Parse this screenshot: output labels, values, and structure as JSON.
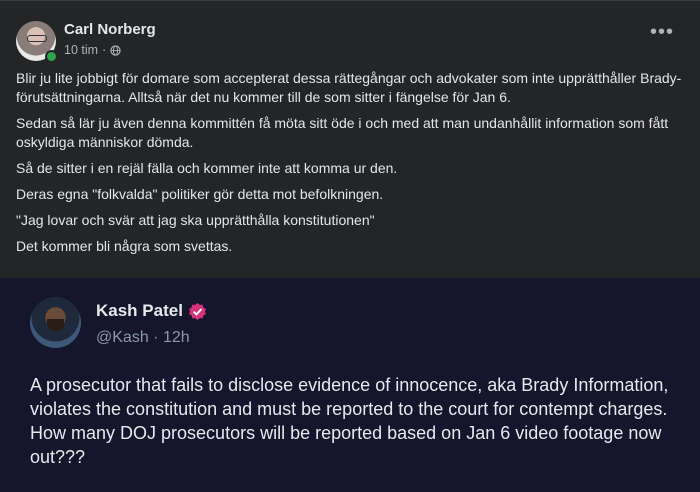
{
  "post": {
    "author": "Carl Norberg",
    "time": "10 tim",
    "separator": "·",
    "privacy_icon": "globe-icon",
    "more_icon": "more-options-icon",
    "paragraphs": [
      "Blir ju lite jobbigt för domare som accepterat dessa rättegångar och advokater som inte upprätthåller Brady-förutsättningarna. Alltså när det nu kommer till de som sitter i fängelse för Jan 6.",
      "Sedan så lär ju även denna kommittén få möta sitt öde i och med att man undanhållit information som fått oskyldiga människor dömda.",
      "Så de sitter i en rejäl fälla och kommer inte att komma ur den.",
      "Deras egna \"folkvalda\" politiker gör detta mot befolkningen.",
      "\"Jag lovar och svär att jag ska upprätthålla konstitutionen\"",
      "Det kommer bli några som svettas."
    ]
  },
  "tweet": {
    "name": "Kash Patel",
    "handle": "@Kash",
    "time": "12h",
    "separator": "·",
    "badge_icon": "verified-badge-icon",
    "text": "A prosecutor that fails to disclose evidence of innocence, aka Brady Information, violates the constitution and must be reported to the court for contempt charges. How many DOJ prosecutors will be reported based on Jan 6 video footage now out???"
  },
  "colors": {
    "post_bg": "#242526",
    "tweet_bg": "#15152e",
    "online_dot": "#31a24c",
    "verified_badge": "#d6337a"
  }
}
